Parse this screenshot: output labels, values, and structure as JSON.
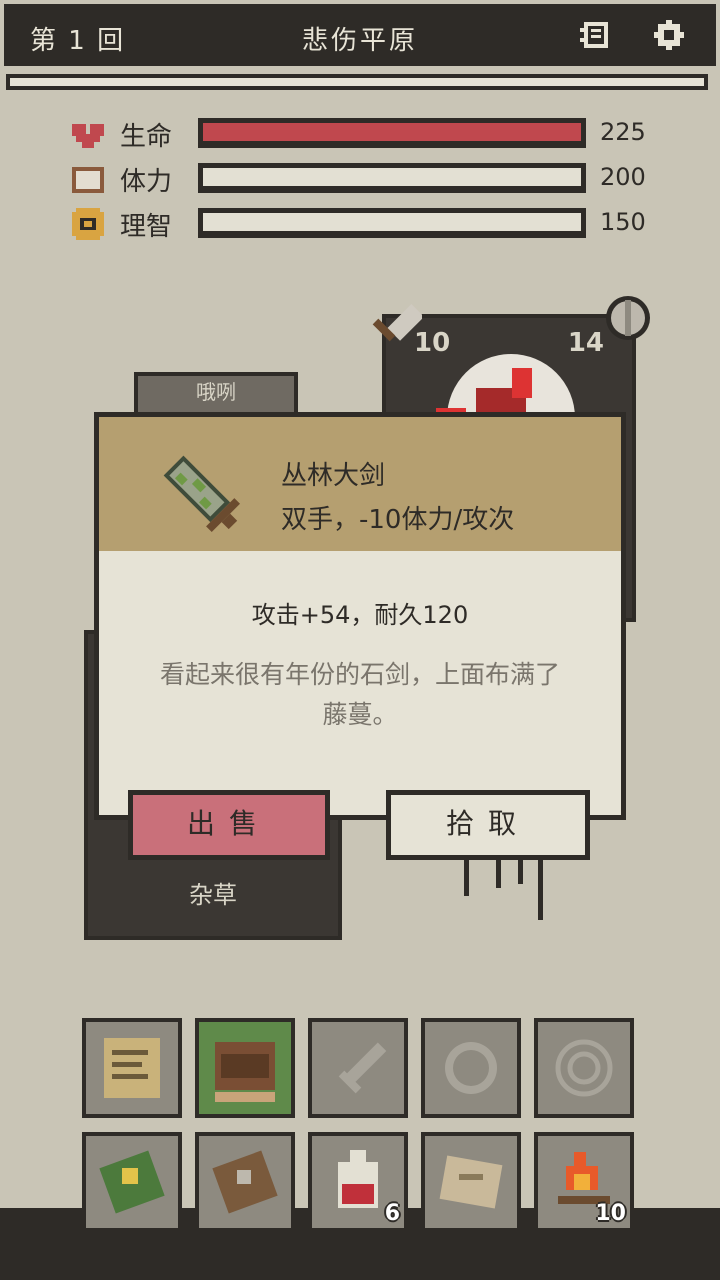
{
  "header": {
    "round_label": "第 1 回",
    "location": "悲伤平原"
  },
  "stats": [
    {
      "label": "生命",
      "value": "225",
      "fill": 1.0,
      "color": "#c0484e",
      "icon": "heart-icon"
    },
    {
      "label": "体力",
      "value": "200",
      "fill": 1.0,
      "color": "#e3e0d3",
      "icon": "bread-icon"
    },
    {
      "label": "理智",
      "value": "150",
      "fill": 1.0,
      "color": "#e3e0d3",
      "icon": "coin-icon"
    }
  ],
  "enemy": {
    "attack": "10",
    "defense": "14"
  },
  "tag_plank": {
    "text": "哦咧"
  },
  "herb_card": {
    "label": "杂草"
  },
  "item_modal": {
    "name": "丛林大剑",
    "type": "双手，-10体力/攻次",
    "stats": "攻击+54，耐久120",
    "description": "看起来很有年份的石剑，上面布满了藤蔓。",
    "sell_label": "出售",
    "pickup_label": "拾取"
  },
  "equipment_slots": [
    {
      "name": "scroll-icon",
      "active": false
    },
    {
      "name": "backpack-icon",
      "active": true
    },
    {
      "name": "sword-slot-icon",
      "active": false
    },
    {
      "name": "shield-slot-icon",
      "active": false
    },
    {
      "name": "amulet-slot-icon",
      "active": false
    }
  ],
  "inventory_slots": [
    {
      "name": "green-book-icon",
      "count": ""
    },
    {
      "name": "brown-book-icon",
      "count": ""
    },
    {
      "name": "red-potion-icon",
      "count": "6"
    },
    {
      "name": "map-icon",
      "count": ""
    },
    {
      "name": "campfire-icon",
      "count": "10"
    }
  ]
}
